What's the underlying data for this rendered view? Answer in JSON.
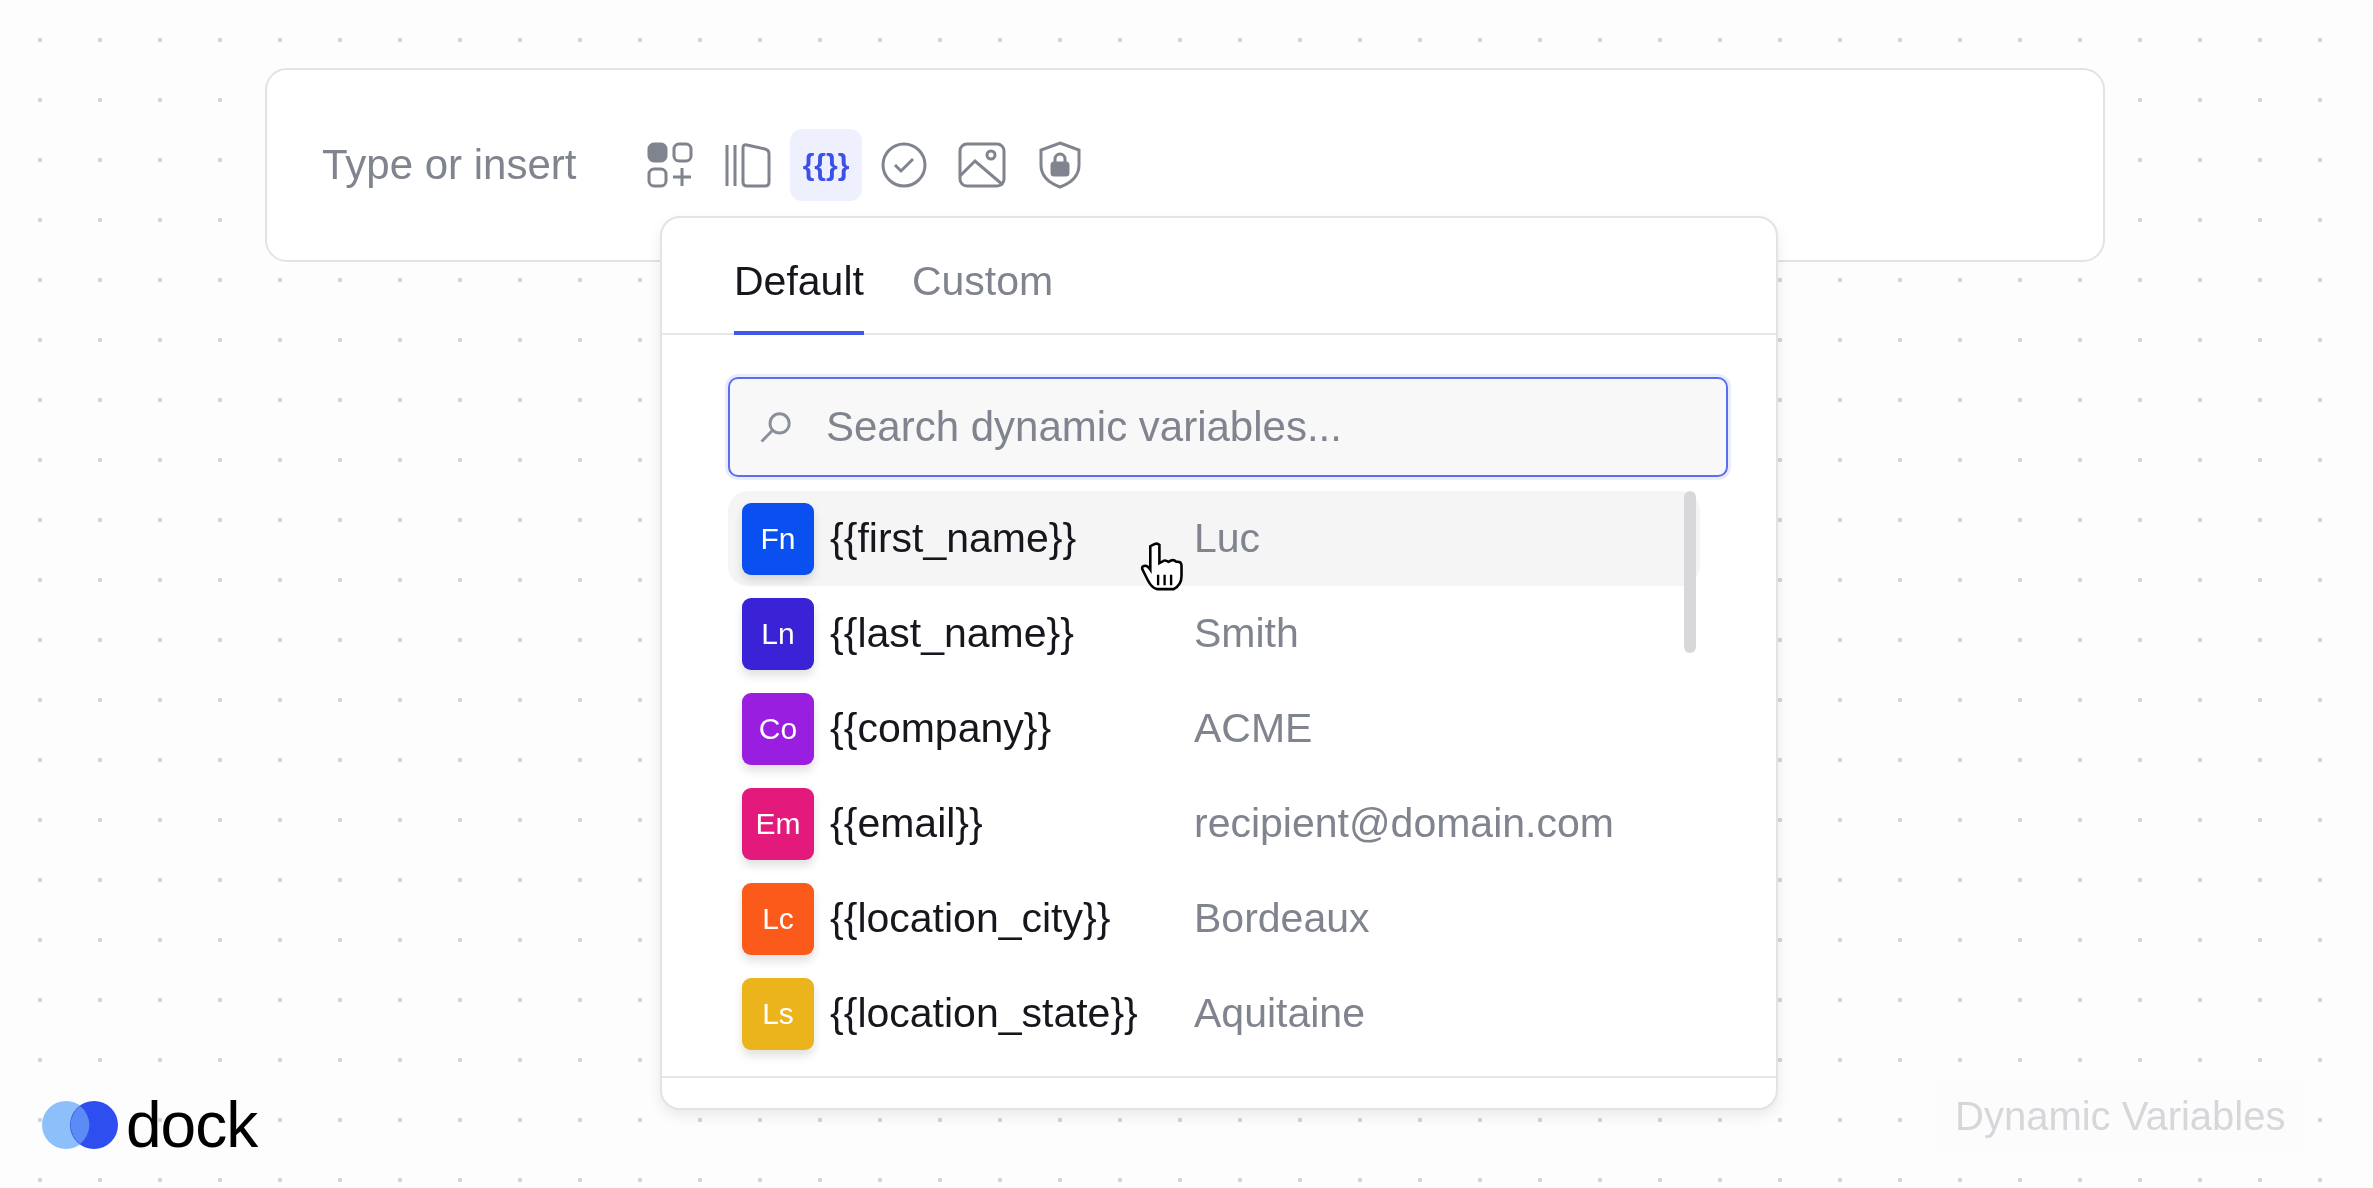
{
  "editor": {
    "placeholder": "Type or insert",
    "tools": [
      {
        "kind": "blocks",
        "active": false
      },
      {
        "kind": "columns",
        "active": false
      },
      {
        "kind": "variables",
        "label": "{{}}",
        "active": true
      },
      {
        "kind": "check",
        "active": false
      },
      {
        "kind": "image",
        "active": false
      },
      {
        "kind": "lock",
        "active": false
      }
    ]
  },
  "popover": {
    "tabs": [
      {
        "label": "Default",
        "selected": true
      },
      {
        "label": "Custom",
        "selected": false
      }
    ],
    "search": {
      "placeholder": "Search dynamic variables..."
    },
    "variables": [
      {
        "badge": "Fn",
        "name": "{{first_name}}",
        "value": "Luc",
        "color": "#0a4ff0",
        "highlighted": true
      },
      {
        "badge": "Ln",
        "name": "{{last_name}}",
        "value": "Smith",
        "color": "#3a22d6",
        "highlighted": false
      },
      {
        "badge": "Co",
        "name": "{{company}}",
        "value": "ACME",
        "color": "#9a1ee0",
        "highlighted": false
      },
      {
        "badge": "Em",
        "name": "{{email}}",
        "value": "recipient@domain.com",
        "color": "#e3197c",
        "highlighted": false
      },
      {
        "badge": "Lc",
        "name": "{{location_city}}",
        "value": "Bordeaux",
        "color": "#fb5a1a",
        "highlighted": false
      },
      {
        "badge": "Ls",
        "name": "{{location_state}}",
        "value": "Aquitaine",
        "color": "#ecb41c",
        "highlighted": false
      }
    ]
  },
  "logo": {
    "text": "dock"
  },
  "caption": "Dynamic Variables"
}
